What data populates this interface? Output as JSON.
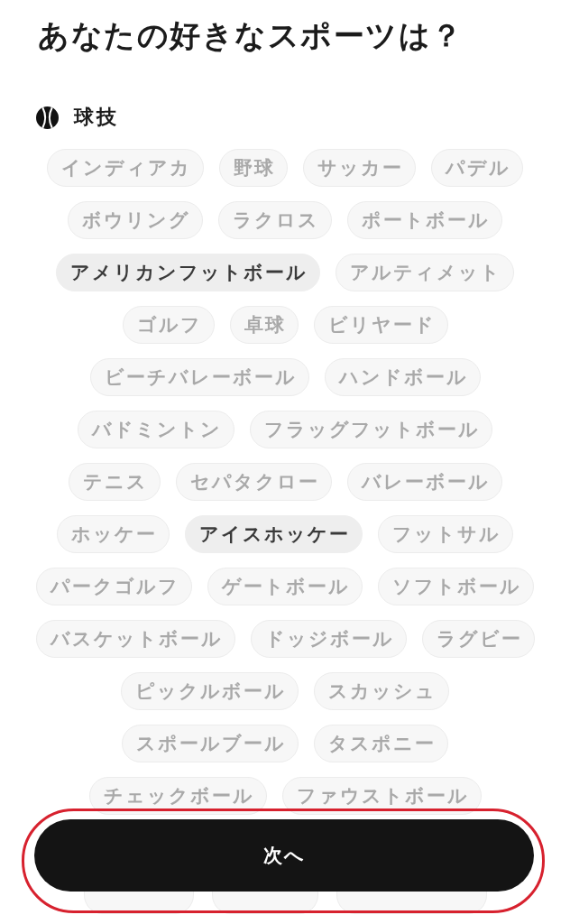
{
  "title": "あなたの好きなスポーツは？",
  "category": {
    "label": "球技",
    "rows": [
      [
        {
          "label": "インディアカ",
          "selected": false
        },
        {
          "label": "野球",
          "selected": false
        },
        {
          "label": "サッカー",
          "selected": false
        },
        {
          "label": "パデル",
          "selected": false
        }
      ],
      [
        {
          "label": "ボウリング",
          "selected": false
        },
        {
          "label": "ラクロス",
          "selected": false
        },
        {
          "label": "ポートボール",
          "selected": false
        }
      ],
      [
        {
          "label": "アメリカンフットボール",
          "selected": true
        },
        {
          "label": "アルティメット",
          "selected": false
        }
      ],
      [
        {
          "label": "ゴルフ",
          "selected": false
        },
        {
          "label": "卓球",
          "selected": false
        },
        {
          "label": "ビリヤード",
          "selected": false
        }
      ],
      [
        {
          "label": "ビーチバレーボール",
          "selected": false
        },
        {
          "label": "ハンドボール",
          "selected": false
        }
      ],
      [
        {
          "label": "バドミントン",
          "selected": false
        },
        {
          "label": "フラッグフットボール",
          "selected": false
        }
      ],
      [
        {
          "label": "テニス",
          "selected": false
        },
        {
          "label": "セパタクロー",
          "selected": false
        },
        {
          "label": "バレーボール",
          "selected": false
        }
      ],
      [
        {
          "label": "ホッケー",
          "selected": false
        },
        {
          "label": "アイスホッケー",
          "selected": true
        },
        {
          "label": "フットサル",
          "selected": false
        }
      ],
      [
        {
          "label": "パークゴルフ",
          "selected": false
        },
        {
          "label": "ゲートボール",
          "selected": false
        },
        {
          "label": "ソフトボール",
          "selected": false
        }
      ],
      [
        {
          "label": "バスケットボール",
          "selected": false
        },
        {
          "label": "ドッジボール",
          "selected": false
        },
        {
          "label": "ラグビー",
          "selected": false
        }
      ],
      [
        {
          "label": "ピックルボール",
          "selected": false
        },
        {
          "label": "スカッシュ",
          "selected": false
        }
      ],
      [
        {
          "label": "スポールブール",
          "selected": false
        },
        {
          "label": "タスポニー",
          "selected": false
        }
      ],
      [
        {
          "label": "チェックボール",
          "selected": false
        },
        {
          "label": "ファウストボール",
          "selected": false
        }
      ]
    ],
    "covered_row": [
      {
        "kind": "chip_bottom"
      },
      {
        "kind": "chip_bottom"
      },
      {
        "kind": "chip_bottom"
      }
    ]
  },
  "next_button": {
    "label": "次へ"
  },
  "annotation": {
    "kind": "ellipse"
  }
}
